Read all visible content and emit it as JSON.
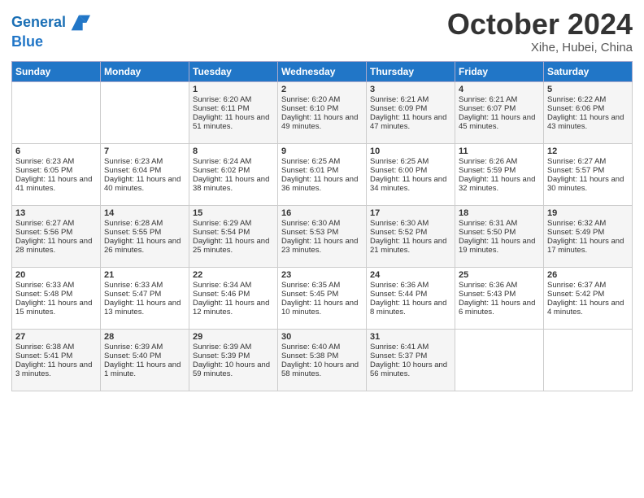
{
  "header": {
    "logo_line1": "General",
    "logo_line2": "Blue",
    "month": "October 2024",
    "location": "Xihe, Hubei, China"
  },
  "weekdays": [
    "Sunday",
    "Monday",
    "Tuesday",
    "Wednesday",
    "Thursday",
    "Friday",
    "Saturday"
  ],
  "weeks": [
    [
      {
        "day": "",
        "sunrise": "",
        "sunset": "",
        "daylight": ""
      },
      {
        "day": "",
        "sunrise": "",
        "sunset": "",
        "daylight": ""
      },
      {
        "day": "1",
        "sunrise": "Sunrise: 6:20 AM",
        "sunset": "Sunset: 6:11 PM",
        "daylight": "Daylight: 11 hours and 51 minutes."
      },
      {
        "day": "2",
        "sunrise": "Sunrise: 6:20 AM",
        "sunset": "Sunset: 6:10 PM",
        "daylight": "Daylight: 11 hours and 49 minutes."
      },
      {
        "day": "3",
        "sunrise": "Sunrise: 6:21 AM",
        "sunset": "Sunset: 6:09 PM",
        "daylight": "Daylight: 11 hours and 47 minutes."
      },
      {
        "day": "4",
        "sunrise": "Sunrise: 6:21 AM",
        "sunset": "Sunset: 6:07 PM",
        "daylight": "Daylight: 11 hours and 45 minutes."
      },
      {
        "day": "5",
        "sunrise": "Sunrise: 6:22 AM",
        "sunset": "Sunset: 6:06 PM",
        "daylight": "Daylight: 11 hours and 43 minutes."
      }
    ],
    [
      {
        "day": "6",
        "sunrise": "Sunrise: 6:23 AM",
        "sunset": "Sunset: 6:05 PM",
        "daylight": "Daylight: 11 hours and 41 minutes."
      },
      {
        "day": "7",
        "sunrise": "Sunrise: 6:23 AM",
        "sunset": "Sunset: 6:04 PM",
        "daylight": "Daylight: 11 hours and 40 minutes."
      },
      {
        "day": "8",
        "sunrise": "Sunrise: 6:24 AM",
        "sunset": "Sunset: 6:02 PM",
        "daylight": "Daylight: 11 hours and 38 minutes."
      },
      {
        "day": "9",
        "sunrise": "Sunrise: 6:25 AM",
        "sunset": "Sunset: 6:01 PM",
        "daylight": "Daylight: 11 hours and 36 minutes."
      },
      {
        "day": "10",
        "sunrise": "Sunrise: 6:25 AM",
        "sunset": "Sunset: 6:00 PM",
        "daylight": "Daylight: 11 hours and 34 minutes."
      },
      {
        "day": "11",
        "sunrise": "Sunrise: 6:26 AM",
        "sunset": "Sunset: 5:59 PM",
        "daylight": "Daylight: 11 hours and 32 minutes."
      },
      {
        "day": "12",
        "sunrise": "Sunrise: 6:27 AM",
        "sunset": "Sunset: 5:57 PM",
        "daylight": "Daylight: 11 hours and 30 minutes."
      }
    ],
    [
      {
        "day": "13",
        "sunrise": "Sunrise: 6:27 AM",
        "sunset": "Sunset: 5:56 PM",
        "daylight": "Daylight: 11 hours and 28 minutes."
      },
      {
        "day": "14",
        "sunrise": "Sunrise: 6:28 AM",
        "sunset": "Sunset: 5:55 PM",
        "daylight": "Daylight: 11 hours and 26 minutes."
      },
      {
        "day": "15",
        "sunrise": "Sunrise: 6:29 AM",
        "sunset": "Sunset: 5:54 PM",
        "daylight": "Daylight: 11 hours and 25 minutes."
      },
      {
        "day": "16",
        "sunrise": "Sunrise: 6:30 AM",
        "sunset": "Sunset: 5:53 PM",
        "daylight": "Daylight: 11 hours and 23 minutes."
      },
      {
        "day": "17",
        "sunrise": "Sunrise: 6:30 AM",
        "sunset": "Sunset: 5:52 PM",
        "daylight": "Daylight: 11 hours and 21 minutes."
      },
      {
        "day": "18",
        "sunrise": "Sunrise: 6:31 AM",
        "sunset": "Sunset: 5:50 PM",
        "daylight": "Daylight: 11 hours and 19 minutes."
      },
      {
        "day": "19",
        "sunrise": "Sunrise: 6:32 AM",
        "sunset": "Sunset: 5:49 PM",
        "daylight": "Daylight: 11 hours and 17 minutes."
      }
    ],
    [
      {
        "day": "20",
        "sunrise": "Sunrise: 6:33 AM",
        "sunset": "Sunset: 5:48 PM",
        "daylight": "Daylight: 11 hours and 15 minutes."
      },
      {
        "day": "21",
        "sunrise": "Sunrise: 6:33 AM",
        "sunset": "Sunset: 5:47 PM",
        "daylight": "Daylight: 11 hours and 13 minutes."
      },
      {
        "day": "22",
        "sunrise": "Sunrise: 6:34 AM",
        "sunset": "Sunset: 5:46 PM",
        "daylight": "Daylight: 11 hours and 12 minutes."
      },
      {
        "day": "23",
        "sunrise": "Sunrise: 6:35 AM",
        "sunset": "Sunset: 5:45 PM",
        "daylight": "Daylight: 11 hours and 10 minutes."
      },
      {
        "day": "24",
        "sunrise": "Sunrise: 6:36 AM",
        "sunset": "Sunset: 5:44 PM",
        "daylight": "Daylight: 11 hours and 8 minutes."
      },
      {
        "day": "25",
        "sunrise": "Sunrise: 6:36 AM",
        "sunset": "Sunset: 5:43 PM",
        "daylight": "Daylight: 11 hours and 6 minutes."
      },
      {
        "day": "26",
        "sunrise": "Sunrise: 6:37 AM",
        "sunset": "Sunset: 5:42 PM",
        "daylight": "Daylight: 11 hours and 4 minutes."
      }
    ],
    [
      {
        "day": "27",
        "sunrise": "Sunrise: 6:38 AM",
        "sunset": "Sunset: 5:41 PM",
        "daylight": "Daylight: 11 hours and 3 minutes."
      },
      {
        "day": "28",
        "sunrise": "Sunrise: 6:39 AM",
        "sunset": "Sunset: 5:40 PM",
        "daylight": "Daylight: 11 hours and 1 minute."
      },
      {
        "day": "29",
        "sunrise": "Sunrise: 6:39 AM",
        "sunset": "Sunset: 5:39 PM",
        "daylight": "Daylight: 10 hours and 59 minutes."
      },
      {
        "day": "30",
        "sunrise": "Sunrise: 6:40 AM",
        "sunset": "Sunset: 5:38 PM",
        "daylight": "Daylight: 10 hours and 58 minutes."
      },
      {
        "day": "31",
        "sunrise": "Sunrise: 6:41 AM",
        "sunset": "Sunset: 5:37 PM",
        "daylight": "Daylight: 10 hours and 56 minutes."
      },
      {
        "day": "",
        "sunrise": "",
        "sunset": "",
        "daylight": ""
      },
      {
        "day": "",
        "sunrise": "",
        "sunset": "",
        "daylight": ""
      }
    ]
  ]
}
